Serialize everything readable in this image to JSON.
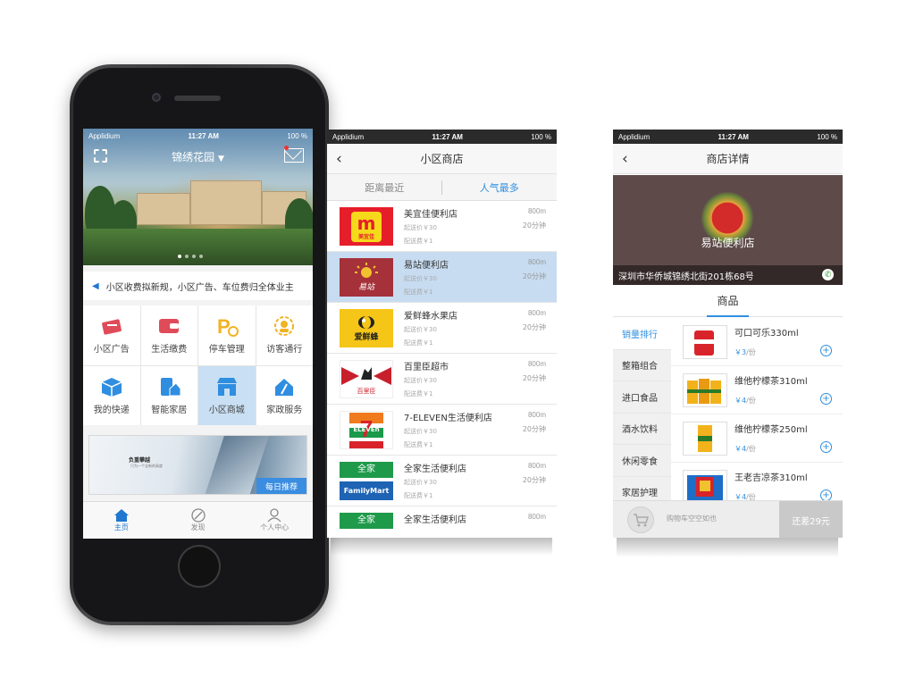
{
  "status": {
    "carrier": "Applidium",
    "time": "11:27 AM",
    "battery": "100 %"
  },
  "home": {
    "community_title": "锦绣花园",
    "notice": "小区收费拟新规，小区广告、车位费归全体业主",
    "services": [
      {
        "label": "小区广告",
        "icon": "ad-icon"
      },
      {
        "label": "生活缴费",
        "icon": "wallet-icon"
      },
      {
        "label": "停车管理",
        "icon": "parking-icon"
      },
      {
        "label": "访客通行",
        "icon": "visitor-icon"
      },
      {
        "label": "我的快递",
        "icon": "package-icon"
      },
      {
        "label": "智能家居",
        "icon": "smart-home-icon"
      },
      {
        "label": "小区商城",
        "icon": "store-icon"
      },
      {
        "label": "家政服务",
        "icon": "housekeeping-icon"
      }
    ],
    "banner": {
      "title": "负重攀越",
      "subtitle": "只为一个全新的高度",
      "tag": "每日推荐"
    },
    "tabs": [
      {
        "label": "主页",
        "icon": "home-icon"
      },
      {
        "label": "发现",
        "icon": "compass-icon"
      },
      {
        "label": "个人中心",
        "icon": "user-icon"
      }
    ]
  },
  "shops": {
    "title": "小区商店",
    "sort_tabs": [
      "距离最近",
      "人气最多"
    ],
    "items": [
      {
        "name": "美宜佳便利店",
        "dist": "800m",
        "time": "20分钟",
        "min": "起送价￥30",
        "fee": "配送费￥1",
        "logo_text": "美宜佳"
      },
      {
        "name": "易站便利店",
        "dist": "800m",
        "time": "20分钟",
        "min": "起送价￥30",
        "fee": "配送费￥1",
        "logo_text": "易站"
      },
      {
        "name": "爱鲜蜂水果店",
        "dist": "800m",
        "time": "20分钟",
        "min": "起送价￥30",
        "fee": "配送费￥1",
        "logo_text": "爱鲜蜂"
      },
      {
        "name": "百里臣超市",
        "dist": "800m",
        "time": "20分钟",
        "min": "起送价￥30",
        "fee": "配送费￥1",
        "logo_text": "百里臣"
      },
      {
        "name": "7-ELEVEN生活便利店",
        "dist": "800m",
        "time": "20分钟",
        "min": "起送价￥30",
        "fee": "配送费￥1",
        "logo_text": "ELEVEn"
      },
      {
        "name": "全家生活便利店",
        "dist": "800m",
        "time": "20分钟",
        "min": "起送价￥30",
        "fee": "配送费￥1",
        "logo_text": "FamilyMart"
      },
      {
        "name": "全家生活便利店",
        "dist": "800m",
        "time": "",
        "min": "",
        "fee": "",
        "logo_text": "全家"
      }
    ]
  },
  "detail": {
    "title": "商店详情",
    "store_name": "易站便利店",
    "address": "深圳市华侨城锦绣北街201栋68号",
    "tab": "商品",
    "categories": [
      "销量排行",
      "整箱组合",
      "进口食品",
      "酒水饮料",
      "休闲零食",
      "家居护理"
    ],
    "goods": [
      {
        "name": "可口可乐330ml",
        "price": "￥3",
        "unit": "/份"
      },
      {
        "name": "维他柠檬茶310ml",
        "price": "￥4",
        "unit": "/份"
      },
      {
        "name": "维他柠檬茶250ml",
        "price": "￥4",
        "unit": "/份"
      },
      {
        "name": "王老吉凉茶310ml",
        "price": "￥4",
        "unit": "/份"
      }
    ],
    "cart_text": "购物车空空如也",
    "need_text": "还差29元"
  }
}
